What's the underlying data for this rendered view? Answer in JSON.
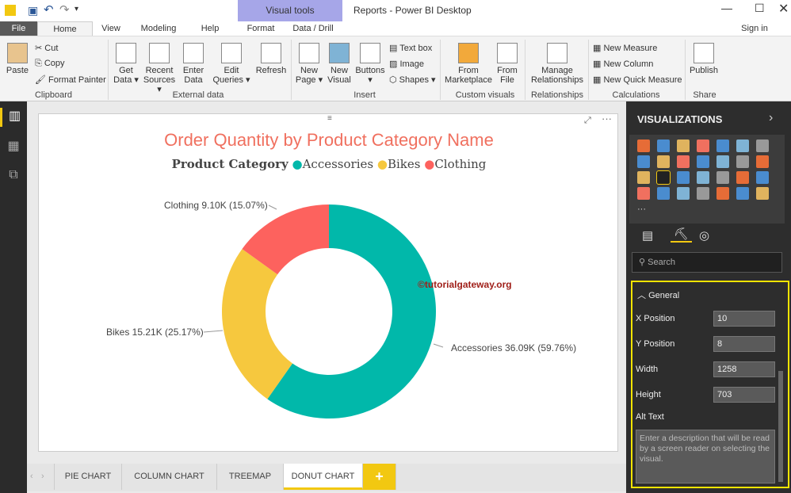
{
  "window": {
    "title": "Reports - Power BI Desktop",
    "visual_tools": "Visual tools",
    "sign_in": "Sign in"
  },
  "tabs": [
    "File",
    "Home",
    "View",
    "Modeling",
    "Help",
    "Format",
    "Data / Drill"
  ],
  "ribbon": {
    "clipboard": {
      "paste": "Paste",
      "cut": "Cut",
      "copy": "Copy",
      "format_painter": "Format Painter",
      "group": "Clipboard"
    },
    "external": {
      "get_data": "Get Data ▾",
      "recent": "Recent Sources ▾",
      "enter": "Enter Data",
      "edit": "Edit Queries ▾",
      "refresh": "Refresh",
      "group": "External data"
    },
    "insert": {
      "new_page": "New Page ▾",
      "new_visual": "New Visual",
      "buttons": "Buttons ▾",
      "text_box": "Text box",
      "image": "Image",
      "shapes": "Shapes ▾",
      "group": "Insert"
    },
    "custom": {
      "marketplace": "From Marketplace",
      "file": "From File",
      "group": "Custom visuals"
    },
    "relationships": {
      "manage": "Manage Relationships",
      "group": "Relationships"
    },
    "calculations": {
      "new_measure": "New Measure",
      "new_column": "New Column",
      "new_quick": "New Quick Measure",
      "group": "Calculations"
    },
    "share": {
      "publish": "Publish",
      "group": "Share"
    }
  },
  "chart_data": {
    "type": "pie",
    "variant": "donut",
    "title": "Order Quantity by Product Category Name",
    "legend_title": "Product Category",
    "legend_position": "top",
    "categories": [
      "Accessories",
      "Bikes",
      "Clothing"
    ],
    "values": [
      36090,
      15210,
      9100
    ],
    "labels": [
      "Accessories 36.09K (59.76%)",
      "Bikes 15.21K (25.17%)",
      "Clothing 9.10K (15.07%)"
    ],
    "colors": [
      "#01b8aa",
      "#f6c83e",
      "#fd625e"
    ],
    "percent": [
      59.76,
      25.17,
      15.07
    ]
  },
  "watermark": "©tutorialgateway.org",
  "visualizations": {
    "title": "VISUALIZATIONS",
    "search_placeholder": "Search",
    "section": "General",
    "fields": [
      {
        "label": "X Position",
        "value": "10"
      },
      {
        "label": "Y Position",
        "value": "8"
      },
      {
        "label": "Width",
        "value": "1258"
      },
      {
        "label": "Height",
        "value": "703"
      }
    ],
    "alt_text_label": "Alt Text",
    "alt_text_placeholder": "Enter a description that will be read by a screen reader on selecting the visual."
  },
  "pages": [
    "PIE CHART",
    "COLUMN CHART",
    "TREEMAP",
    "DONUT CHART"
  ],
  "add_page": "+"
}
